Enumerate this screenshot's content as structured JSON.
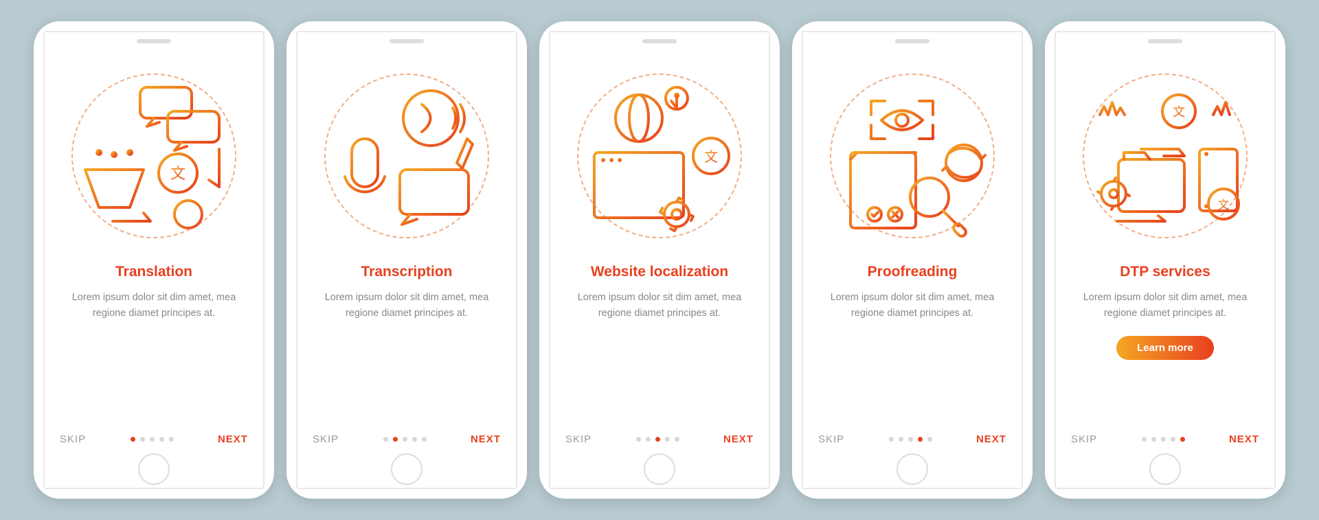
{
  "screens": [
    {
      "title": "Translation",
      "desc": "Lorem ipsum dolor sit dim amet, mea regione diamet principes at.",
      "skip": "SKIP",
      "next": "NEXT",
      "active": 0,
      "learn": false
    },
    {
      "title": "Transcription",
      "desc": "Lorem ipsum dolor sit dim amet, mea regione diamet principes at.",
      "skip": "SKIP",
      "next": "NEXT",
      "active": 1,
      "learn": false
    },
    {
      "title": "Website localization",
      "desc": "Lorem ipsum dolor sit dim amet, mea regione diamet principes at.",
      "skip": "SKIP",
      "next": "NEXT",
      "active": 2,
      "learn": false
    },
    {
      "title": "Proofreading",
      "desc": "Lorem ipsum dolor sit dim amet, mea regione diamet principes at.",
      "skip": "SKIP",
      "next": "NEXT",
      "active": 3,
      "learn": false
    },
    {
      "title": "DTP services",
      "desc": "Lorem ipsum dolor sit dim amet, mea regione diamet principes at.",
      "skip": "SKIP",
      "next": "NEXT",
      "active": 4,
      "learn": true,
      "learn_label": "Learn more"
    }
  ],
  "total_dots": 5,
  "colors": {
    "grad_start": "#f5a623",
    "grad_end": "#e8401f",
    "bg": "#b8cbd1"
  }
}
